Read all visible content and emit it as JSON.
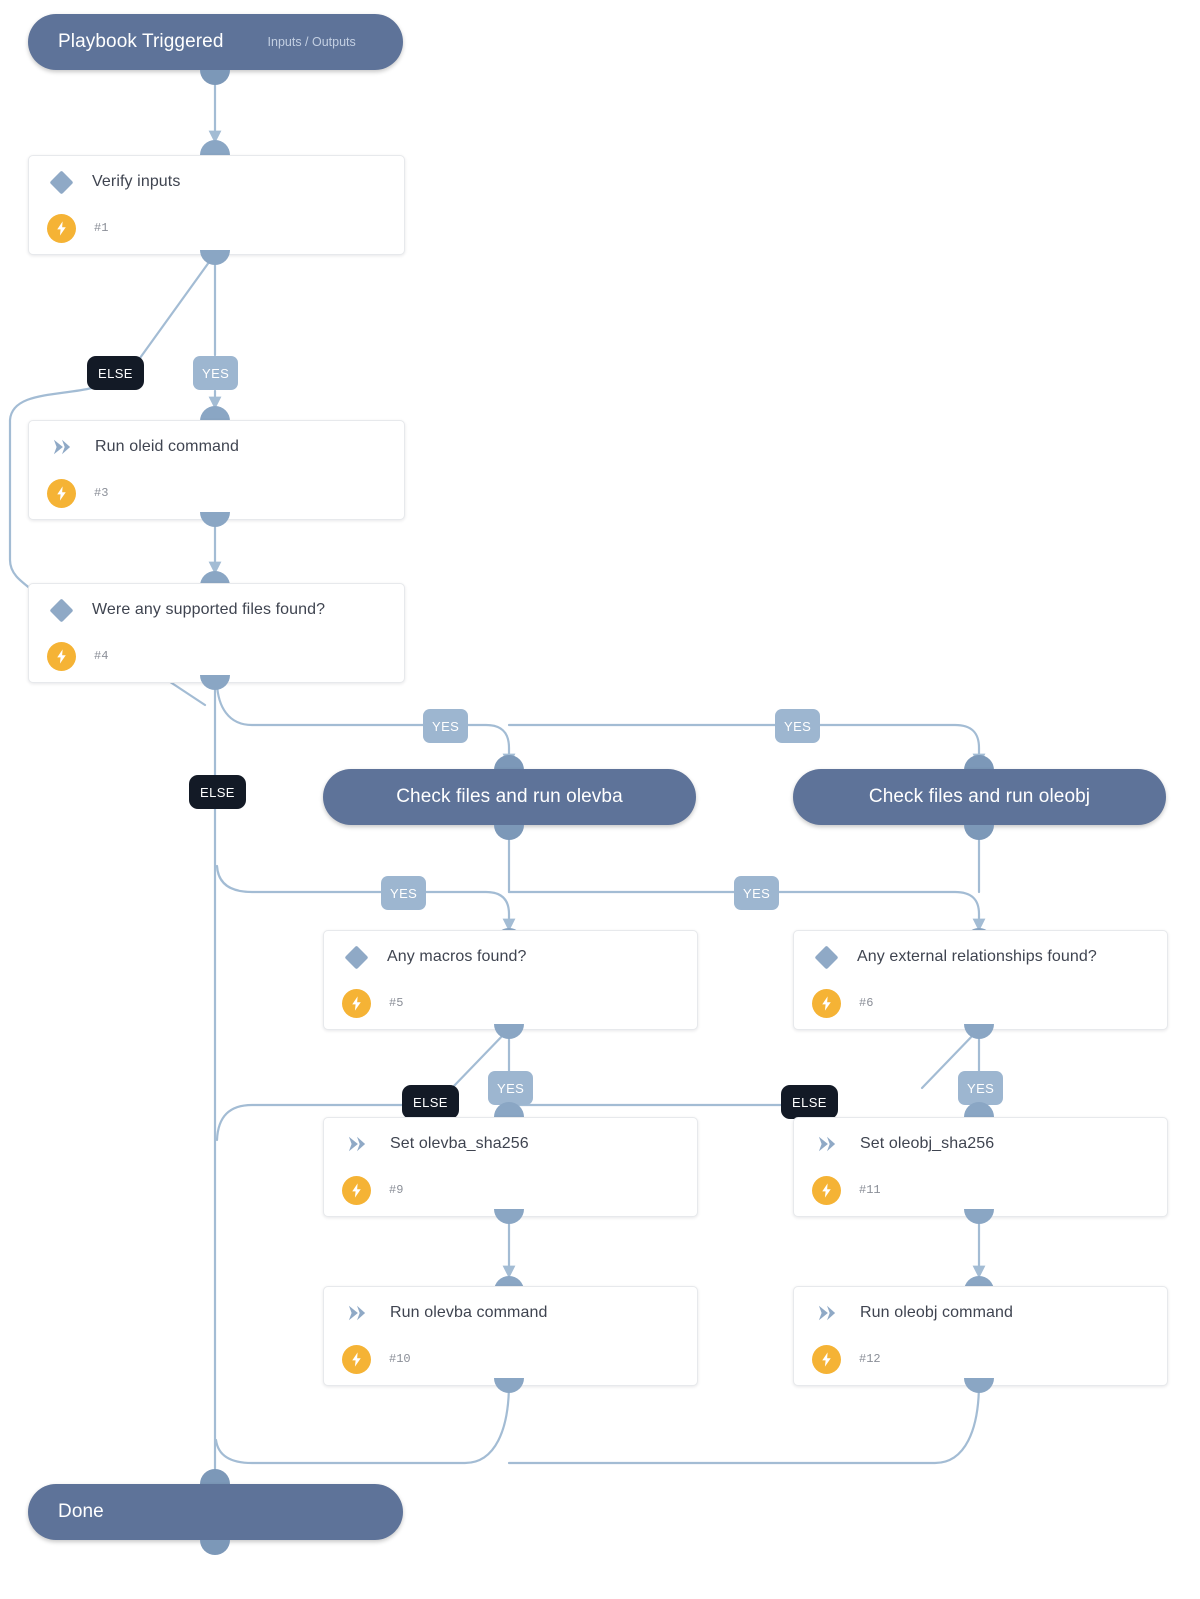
{
  "diagram": {
    "title": "Playbook flow",
    "colors": {
      "pill": "#5e7399",
      "card_border": "#e7e9ec",
      "edge": "#a3bcd4",
      "yes_badge": "#9db6d0",
      "else_badge": "#131a26",
      "bolt": "#f5b335",
      "diamond": "#8fa9c6"
    }
  },
  "trigger": {
    "label": "Playbook Triggered",
    "sublabel": "Inputs / Outputs"
  },
  "sections": [
    {
      "id": "sec_olevba",
      "label": "Check files and run olevba"
    },
    {
      "id": "sec_oleobj",
      "label": "Check files and run oleobj"
    }
  ],
  "end": {
    "label": "Done"
  },
  "tasks": [
    {
      "id": "t1",
      "label": "Verify inputs",
      "number": "#1",
      "icon": "condition-diamond-icon"
    },
    {
      "id": "t3",
      "label": "Run oleid command",
      "number": "#3",
      "icon": "command-chevron-icon"
    },
    {
      "id": "t4",
      "label": "Were any supported files found?",
      "number": "#4",
      "icon": "condition-diamond-icon"
    },
    {
      "id": "t5",
      "label": "Any macros found?",
      "number": "#5",
      "icon": "condition-diamond-icon"
    },
    {
      "id": "t6",
      "label": "Any external relationships found?",
      "number": "#6",
      "icon": "condition-diamond-icon"
    },
    {
      "id": "t9",
      "label": "Set olevba_sha256",
      "number": "#9",
      "icon": "command-chevron-icon"
    },
    {
      "id": "t11",
      "label": "Set oleobj_sha256",
      "number": "#11",
      "icon": "command-chevron-icon"
    },
    {
      "id": "t10",
      "label": "Run olevba command",
      "number": "#10",
      "icon": "command-chevron-icon"
    },
    {
      "id": "t12",
      "label": "Run oleobj command",
      "number": "#12",
      "icon": "command-chevron-icon"
    }
  ],
  "branch_labels": [
    {
      "id": "b1_else",
      "type": "else",
      "text": "ELSE",
      "from": "t1"
    },
    {
      "id": "b1_yes",
      "type": "yes",
      "text": "YES",
      "from": "t1"
    },
    {
      "id": "b4_else",
      "type": "else",
      "text": "ELSE",
      "from": "t4"
    },
    {
      "id": "b4_yes_l",
      "type": "yes",
      "text": "YES",
      "from": "t4"
    },
    {
      "id": "b4_yes_r",
      "type": "yes",
      "text": "YES",
      "from": "t4"
    },
    {
      "id": "bsec_yes_l",
      "type": "yes",
      "text": "YES",
      "from": "sec_olevba"
    },
    {
      "id": "bsec_yes_r",
      "type": "yes",
      "text": "YES",
      "from": "sec_oleobj"
    },
    {
      "id": "b5_else",
      "type": "else",
      "text": "ELSE",
      "from": "t5"
    },
    {
      "id": "b5_yes",
      "type": "yes",
      "text": "YES",
      "from": "t5"
    },
    {
      "id": "b6_else",
      "type": "else",
      "text": "ELSE",
      "from": "t6"
    },
    {
      "id": "b6_yes",
      "type": "yes",
      "text": "YES",
      "from": "t6"
    }
  ]
}
